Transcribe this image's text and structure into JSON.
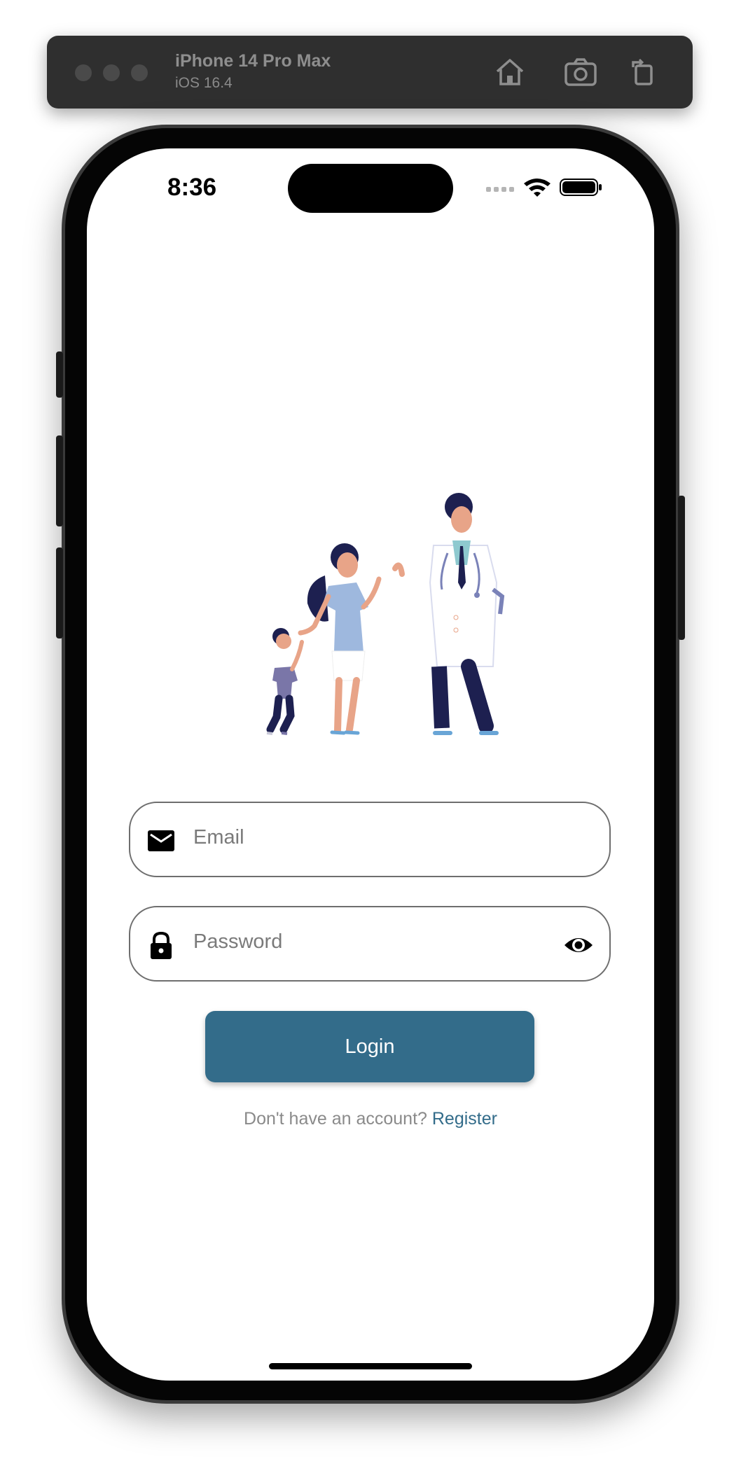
{
  "simulator": {
    "device_name": "iPhone 14 Pro Max",
    "os_version": "iOS 16.4"
  },
  "status_bar": {
    "time": "8:36"
  },
  "login": {
    "email_placeholder": "Email",
    "password_placeholder": "Password",
    "login_label": "Login",
    "no_account_text": "Don't have an account? ",
    "register_label": "Register"
  },
  "colors": {
    "primary": "#336c8a",
    "field_border": "#6e6e6e",
    "placeholder": "#7a7a7a"
  },
  "icons": {
    "toolbar": [
      "home-icon",
      "screenshot-icon",
      "rotate-icon"
    ],
    "email": "mail-icon",
    "password": "lock-icon",
    "visibility": "eye-icon"
  }
}
